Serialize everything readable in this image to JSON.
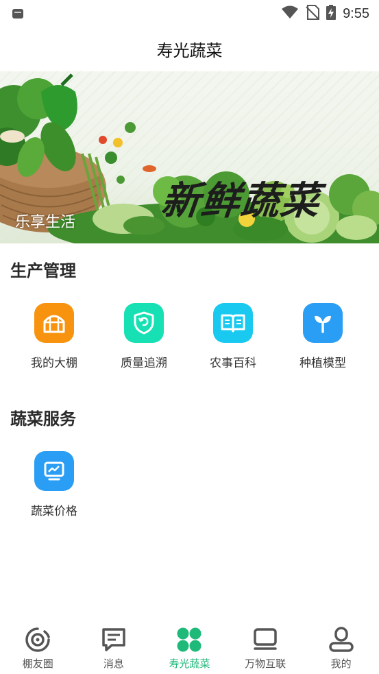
{
  "status_bar": {
    "time": "9:55",
    "icons": [
      "notification-app-icon",
      "wifi-icon",
      "no-sim-icon",
      "battery-charging-icon"
    ]
  },
  "header": {
    "title": "寿光蔬菜"
  },
  "banner": {
    "headline": "新鲜蔬菜",
    "caption": "乐享生活"
  },
  "production": {
    "title": "生产管理",
    "items": [
      {
        "label": "我的大棚",
        "icon": "greenhouse-icon",
        "color": "#f7930e"
      },
      {
        "label": "质量追溯",
        "icon": "trace-shield-icon",
        "color": "#16e0b4"
      },
      {
        "label": "农事百科",
        "icon": "open-book-icon",
        "color": "#19c9ef"
      },
      {
        "label": "种植模型",
        "icon": "sprout-icon",
        "color": "#2a9df4"
      }
    ]
  },
  "vegetable_service": {
    "title": "蔬菜服务",
    "items": [
      {
        "label": "蔬菜价格",
        "icon": "price-chart-icon",
        "color": "#2a9df4"
      }
    ]
  },
  "bottom_nav": {
    "active_color": "#1fb97a",
    "inactive_color": "#555555",
    "items": [
      {
        "label": "棚友圈",
        "icon": "circle-feed-icon"
      },
      {
        "label": "消息",
        "icon": "message-icon"
      },
      {
        "label": "寿光蔬菜",
        "icon": "four-leaf-icon",
        "active": true
      },
      {
        "label": "万物互联",
        "icon": "monitor-icon"
      },
      {
        "label": "我的",
        "icon": "user-icon"
      }
    ]
  }
}
